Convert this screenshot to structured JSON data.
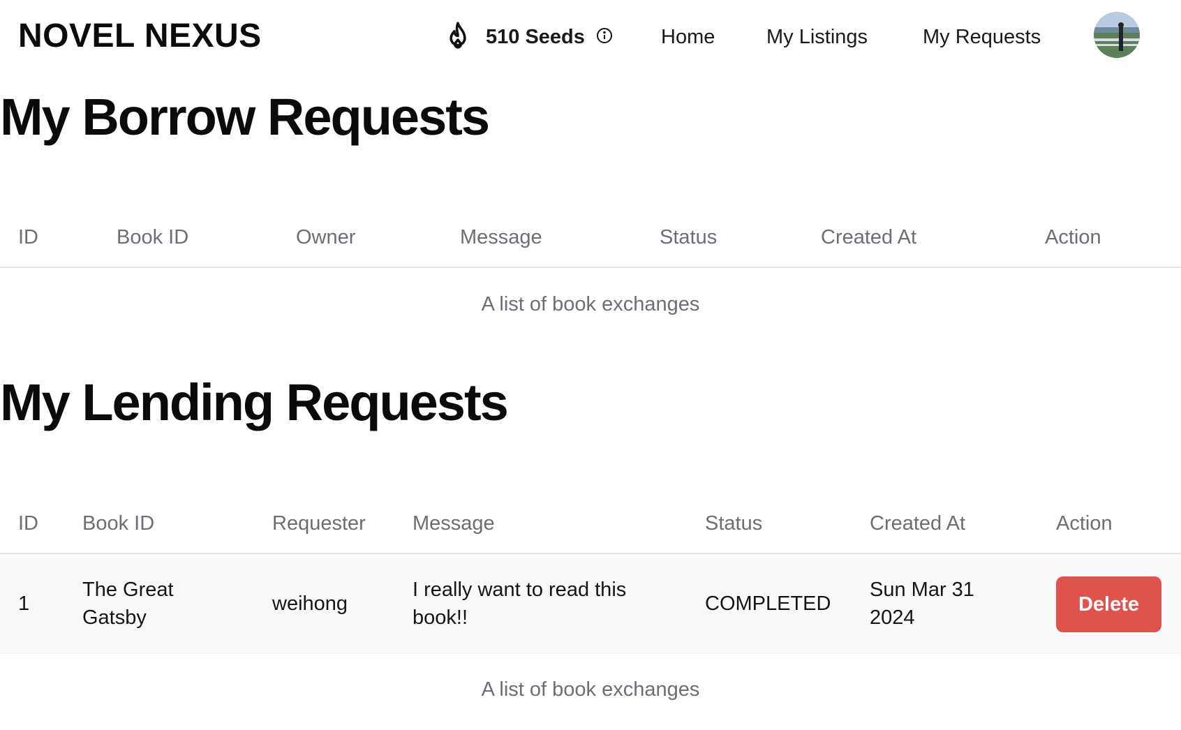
{
  "brand": "NOVEL NEXUS",
  "seeds": {
    "label": "510 Seeds"
  },
  "nav": {
    "home": "Home",
    "listings": "My Listings",
    "requests": "My Requests"
  },
  "borrow": {
    "title": "My Borrow Requests",
    "headers": [
      "ID",
      "Book ID",
      "Owner",
      "Message",
      "Status",
      "Created At",
      "Action"
    ],
    "rows": [],
    "caption": "A list of book exchanges"
  },
  "lending": {
    "title": "My Lending Requests",
    "headers": [
      "ID",
      "Book ID",
      "Requester",
      "Message",
      "Status",
      "Created At",
      "Action"
    ],
    "rows": [
      {
        "id": "1",
        "book_line1": "The Great",
        "book_line2": "Gatsby",
        "requester": "weihong",
        "message_line1": "I really want to read this",
        "message_line2": "book!!",
        "status": "COMPLETED",
        "created_line1": "Sun Mar 31",
        "created_line2": "2024",
        "action": "Delete"
      }
    ],
    "caption": "A list of book exchanges"
  },
  "colors": {
    "delete_button": "#e0524c",
    "header_text": "#6b6e76",
    "row_background": "#f9f9f9"
  }
}
